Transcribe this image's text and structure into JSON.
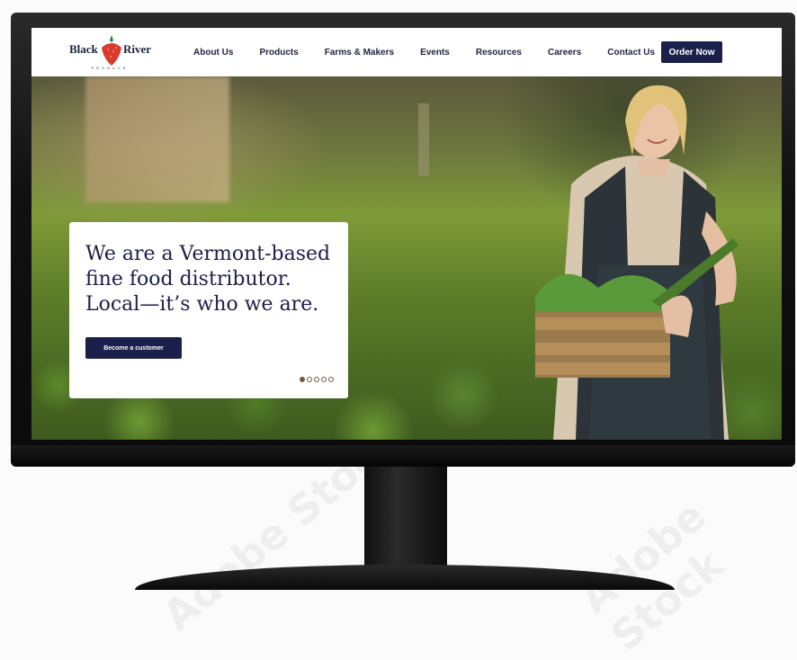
{
  "logo": {
    "left_text": "Black",
    "right_text": "River",
    "subtitle": "PRODUCE",
    "icon": "strawberry-icon"
  },
  "nav": {
    "items": [
      "About Us",
      "Products",
      "Farms & Makers",
      "Events",
      "Resources",
      "Careers",
      "Contact Us"
    ],
    "cta": "Order Now"
  },
  "hero": {
    "headline": "We are a Vermont-based fine food distributor. Local—it’s who we are.",
    "button": "Become a customer",
    "carousel": {
      "count": 5,
      "active": 1
    }
  },
  "watermark": "Adobe Stock",
  "colors": {
    "navy": "#1b1f4b",
    "accent_dot": "#6d5a3c",
    "strawberry": "#d93a2b",
    "leaf": "#2e7d32"
  }
}
